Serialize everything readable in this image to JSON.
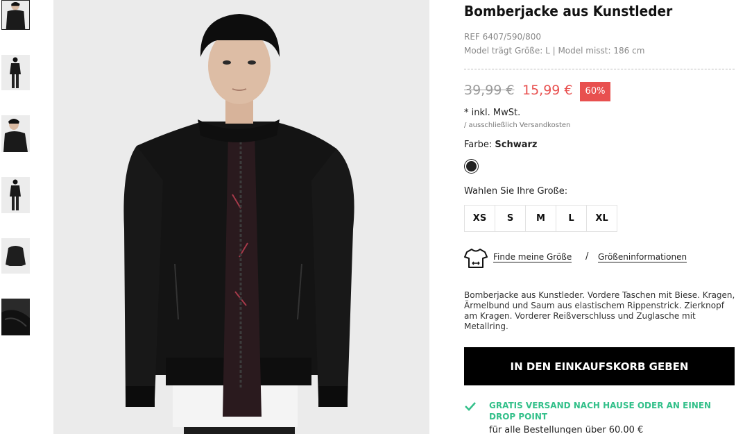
{
  "product": {
    "title": "Bomberjacke aus Kunstleder",
    "ref": "REF 6407/590/800",
    "model_info": "Model trägt Größe: L | Model misst: 186 cm"
  },
  "price": {
    "old": "39,99 €",
    "new": "15,99 €",
    "discount": "60%",
    "tax_note": "* inkl. MwSt.",
    "shipping_note": "/ ausschließlich Versandkosten"
  },
  "color": {
    "label": "Farbe:",
    "value": "Schwarz",
    "swatch_hex": "#222222"
  },
  "sizes": {
    "label": "Wahlen Sie Ihre Große:",
    "options": [
      "XS",
      "S",
      "M",
      "L",
      "XL"
    ]
  },
  "size_links": {
    "find": "Finde meine Größe",
    "separator": "/",
    "info": "Größeninformationen",
    "icon": "tshirt-icon"
  },
  "description": "Bomberjacke aus Kunstleder. Vordere Taschen mit Biese. Kragen, Ärmelbund und Saum aus elastischem Rippenstrick. Zierknopf am Kragen. Vorderer Reißverschluss und Zuglasche mit Metallring.",
  "cart_button": "IN DEN EINKAUFSKORB GEBEN",
  "shipping_promo": {
    "title": "GRATIS VERSAND NACH HAUSE ODER AN EINEN DROP POINT",
    "subtitle": "für alle Bestellungen über 60.00 €",
    "icon": "check-icon"
  },
  "colors": {
    "sale": "#e8504f",
    "promo": "#33c08a",
    "button": "#000000"
  }
}
